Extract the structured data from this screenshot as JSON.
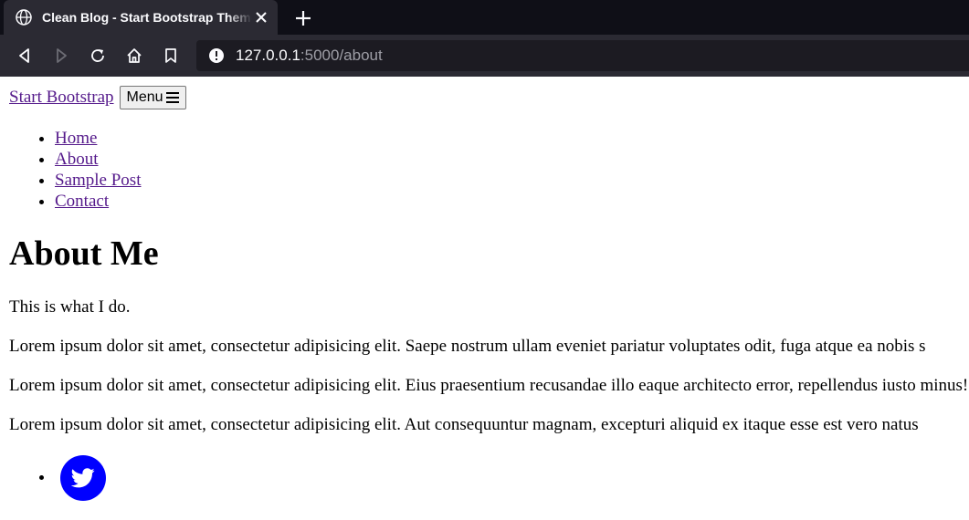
{
  "browser": {
    "tab_title": "Clean Blog - Start Bootstrap Theme",
    "url_host": "127.0.0.1",
    "url_rest": ":5000/about"
  },
  "site": {
    "brand": "Start Bootstrap",
    "menu_label": "Menu",
    "nav": [
      {
        "label": "Home"
      },
      {
        "label": "About"
      },
      {
        "label": "Sample Post"
      },
      {
        "label": "Contact"
      }
    ]
  },
  "main": {
    "heading": "About Me",
    "intro": "This is what I do.",
    "paragraphs": [
      "Lorem ipsum dolor sit amet, consectetur adipisicing elit. Saepe nostrum ullam eveniet pariatur voluptates odit, fuga atque ea nobis s",
      "Lorem ipsum dolor sit amet, consectetur adipisicing elit. Eius praesentium recusandae illo eaque architecto error, repellendus iusto minus!",
      "Lorem ipsum dolor sit amet, consectetur adipisicing elit. Aut consequuntur magnam, excepturi aliquid ex itaque esse est vero natus"
    ]
  },
  "social": {
    "icons": [
      "twitter-icon"
    ],
    "twitter_color": "#0000ff"
  },
  "colors": {
    "tab_bar": "#0f0f17",
    "toolbar": "#2b2a33",
    "urlbar": "#1c1b22",
    "link": "#551a8b"
  }
}
